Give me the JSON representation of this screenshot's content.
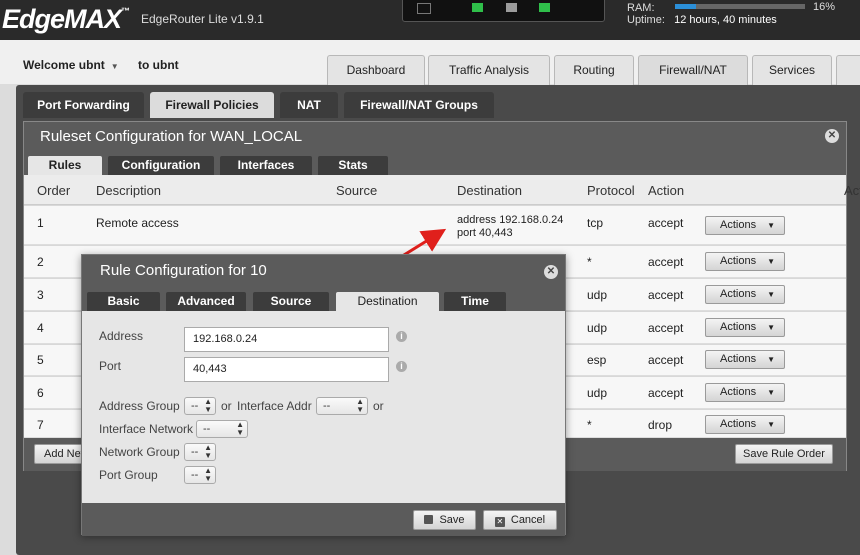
{
  "header": {
    "logo": "EdgeMAX",
    "model": "EdgeRouter Lite v1.9.1",
    "ram_label": "RAM:",
    "ram_percent_text": "16%",
    "ram_fraction": 0.16,
    "uptime_label": "Uptime:",
    "uptime_value": "12 hours, 40 minutes",
    "port_colors": [
      "#2fbf4a",
      "#9c9c9c",
      "#2fbf4a"
    ]
  },
  "user": {
    "welcome": "Welcome ubnt",
    "to": "to ubnt"
  },
  "main_tabs": [
    "Dashboard",
    "Traffic Analysis",
    "Routing",
    "Firewall/NAT",
    "Services"
  ],
  "sub_tabs": [
    "Port Forwarding",
    "Firewall Policies",
    "NAT",
    "Firewall/NAT Groups"
  ],
  "ruleset": {
    "title": "Ruleset Configuration for WAN_LOCAL",
    "tabs": [
      "Rules",
      "Configuration",
      "Interfaces",
      "Stats"
    ],
    "columns": [
      "Order",
      "Description",
      "Source",
      "Destination",
      "Protocol",
      "Action",
      "Actio"
    ],
    "rows": [
      {
        "order": "1",
        "description": "Remote access",
        "dest1": "address 192.168.0.24",
        "dest2": "port 40,443",
        "protocol": "tcp",
        "action": "accept"
      },
      {
        "order": "2",
        "description": "",
        "dest1": "",
        "dest2": "",
        "protocol": "*",
        "action": "accept"
      },
      {
        "order": "3",
        "description": "",
        "dest1": "",
        "dest2": "",
        "protocol": "udp",
        "action": "accept"
      },
      {
        "order": "4",
        "description": "",
        "dest1": "",
        "dest2": "",
        "protocol": "udp",
        "action": "accept"
      },
      {
        "order": "5",
        "description": "",
        "dest1": "",
        "dest2": "",
        "protocol": "esp",
        "action": "accept"
      },
      {
        "order": "6",
        "description": "",
        "dest1": "",
        "dest2": "",
        "protocol": "udp",
        "action": "accept"
      },
      {
        "order": "7",
        "description": "",
        "dest1": "",
        "dest2": "",
        "protocol": "*",
        "action": "drop"
      }
    ],
    "actions_label": "Actions",
    "add_new": "Add New",
    "save_order": "Save Rule Order"
  },
  "rule_config": {
    "title": "Rule Configuration for 10",
    "tabs": [
      "Basic",
      "Advanced",
      "Source",
      "Destination",
      "Time"
    ],
    "address_label": "Address",
    "address_value": "192.168.0.24",
    "port_label": "Port",
    "port_value": "40,443",
    "address_group_label": "Address Group",
    "or1": "or",
    "interface_addr_label": "Interface Addr",
    "or2": "or",
    "interface_network_label": "Interface Network",
    "network_group_label": "Network Group",
    "port_group_label": "Port Group",
    "select_value": "--",
    "save": "Save",
    "cancel": "Cancel"
  }
}
